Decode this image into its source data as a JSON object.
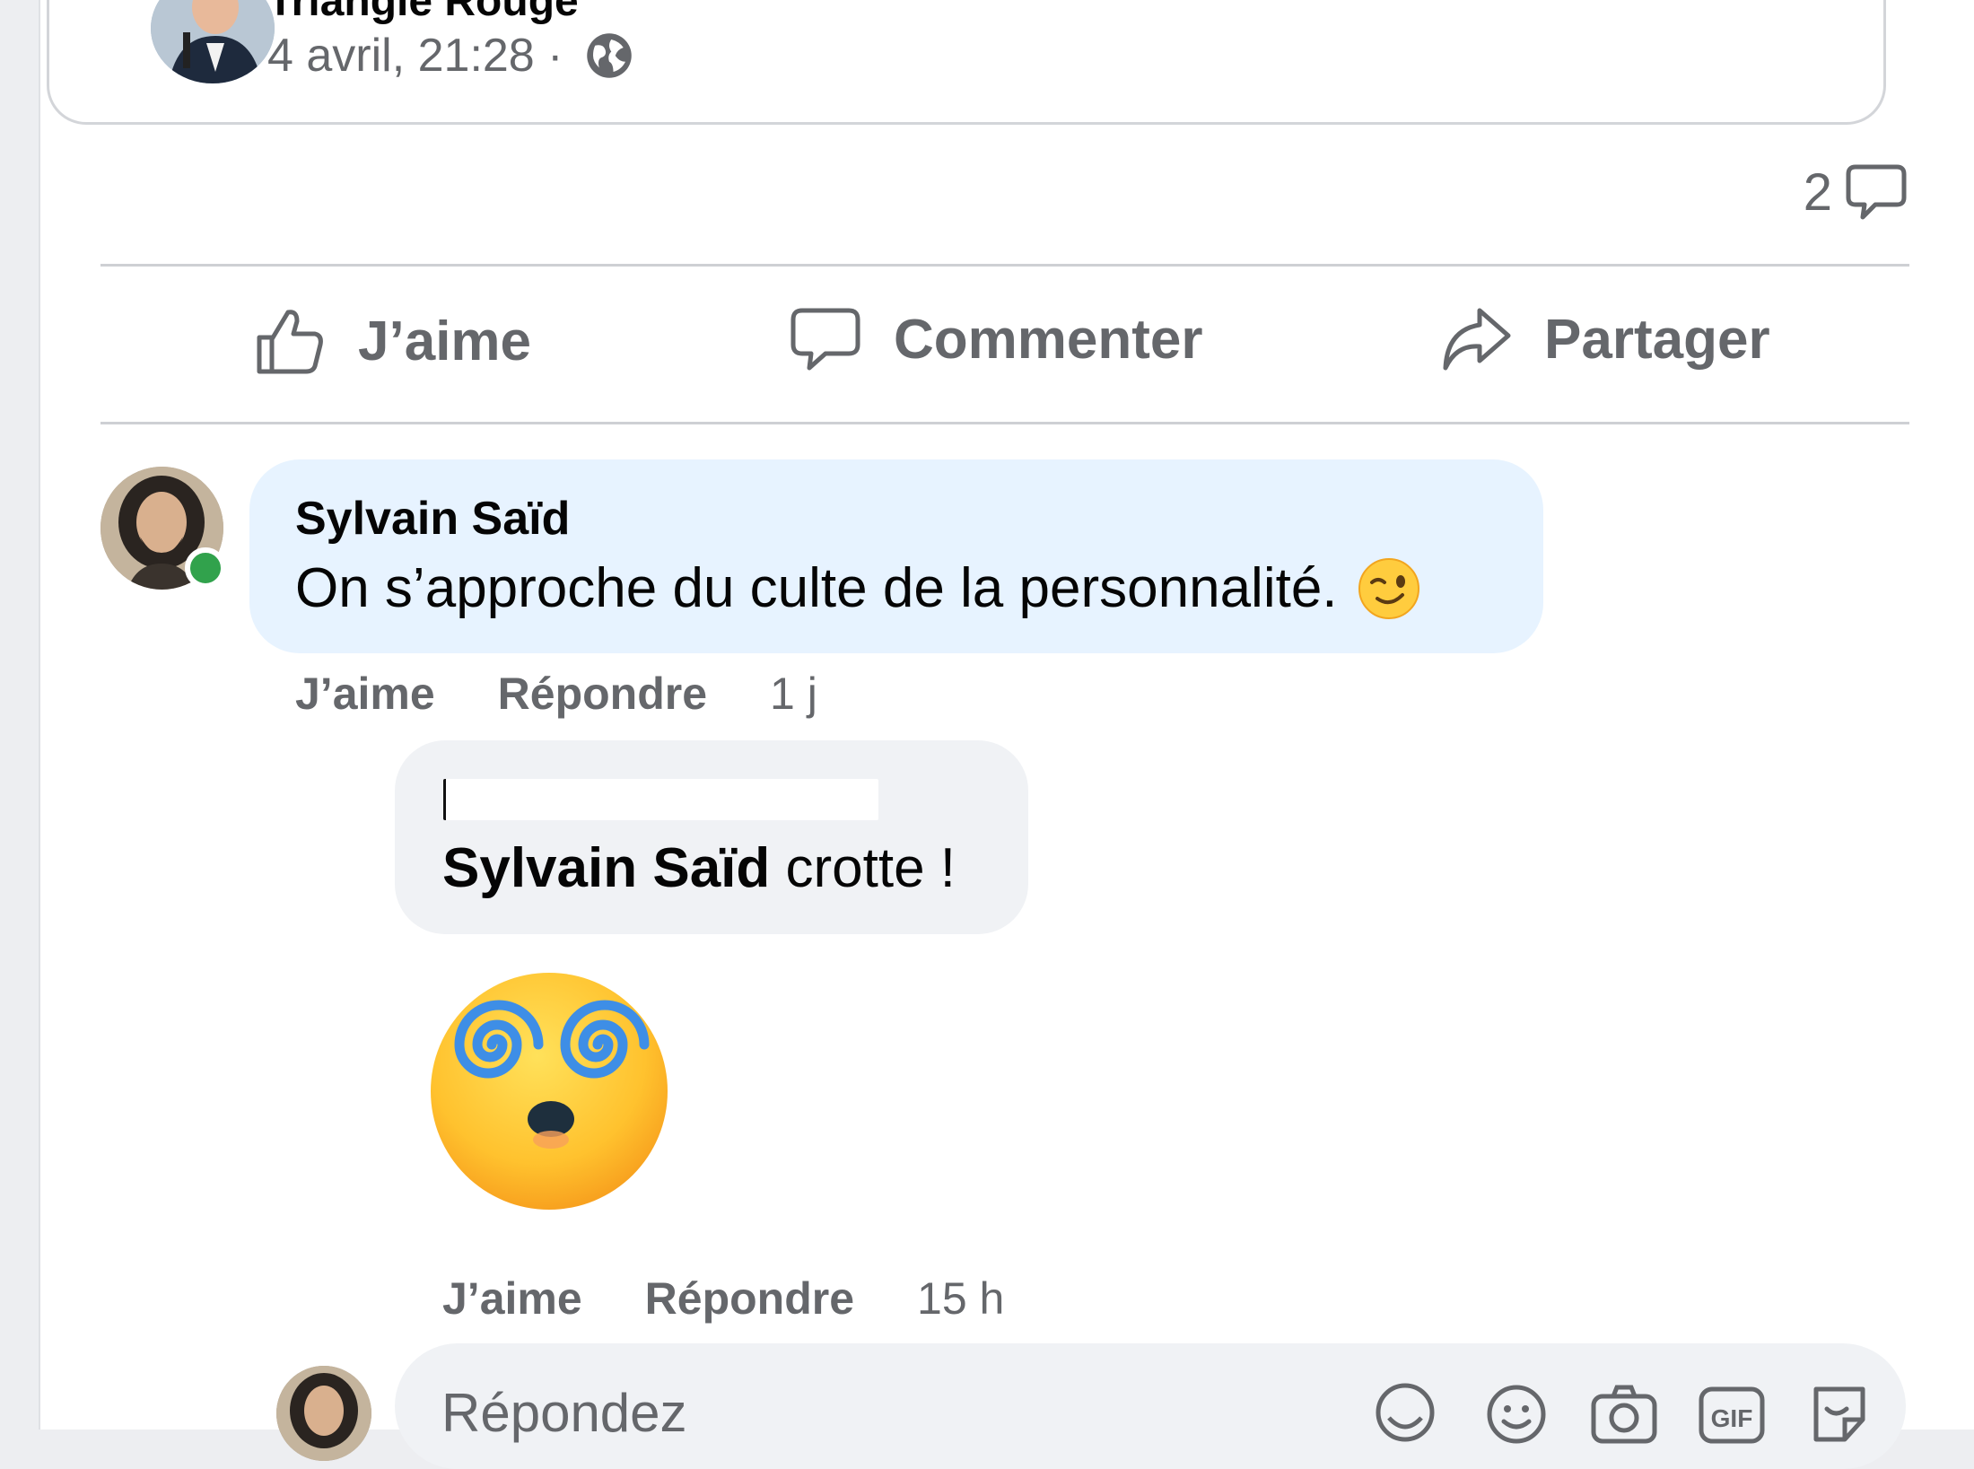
{
  "post": {
    "author_name": "Triangle Rouge",
    "timestamp": "4 avril, 21:28 ·",
    "privacy_icon": "globe-icon",
    "comment_count": "2"
  },
  "actions": {
    "like_label": "J’aime",
    "comment_label": "Commenter",
    "share_label": "Partager"
  },
  "comments": [
    {
      "author": "Sylvain Saïd",
      "text": "On s’approche du culte de la personnalité.",
      "emoji": "winking-face",
      "like_label": "J’aime",
      "reply_label": "Répondre",
      "time": "1 j",
      "online": true
    }
  ],
  "reply": {
    "mention": "Sylvain Saïd",
    "text": " crotte !",
    "sticker": "dizzy-face-sticker",
    "like_label": "J’aime",
    "reply_label": "Répondre",
    "time": "15 h"
  },
  "composer": {
    "placeholder": "Répondez",
    "icons": [
      "avatar-sticker-icon",
      "emoji-icon",
      "camera-icon",
      "gif-icon",
      "sticker-icon"
    ]
  },
  "colors": {
    "comment_bubble": "#e7f3ff",
    "reply_bubble": "#f0f2f5",
    "secondary_text": "#65676b",
    "online": "#31a24c"
  }
}
